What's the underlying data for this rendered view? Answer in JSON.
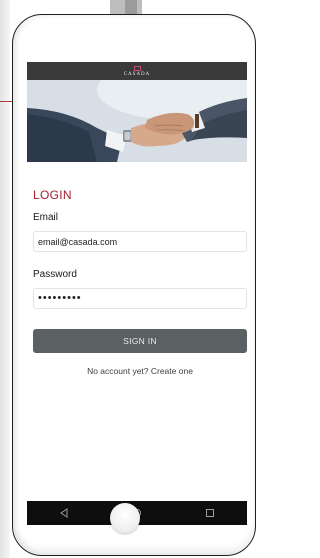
{
  "app": {
    "logo_text": "CASADA"
  },
  "login": {
    "title": "LOGIN",
    "email_label": "Email",
    "email_value": "email@casada.com",
    "password_label": "Password",
    "password_value": "•••••••••",
    "signin_label": "SIGN IN",
    "create_account_text": "No account yet? Create one"
  },
  "nav_icons": [
    "back-icon",
    "home-icon",
    "recents-icon"
  ],
  "colors": {
    "accent": "#a21f2e",
    "button": "#5b6163",
    "app_bar": "#3a3a3a",
    "nav_bar": "#0e0e0e"
  }
}
